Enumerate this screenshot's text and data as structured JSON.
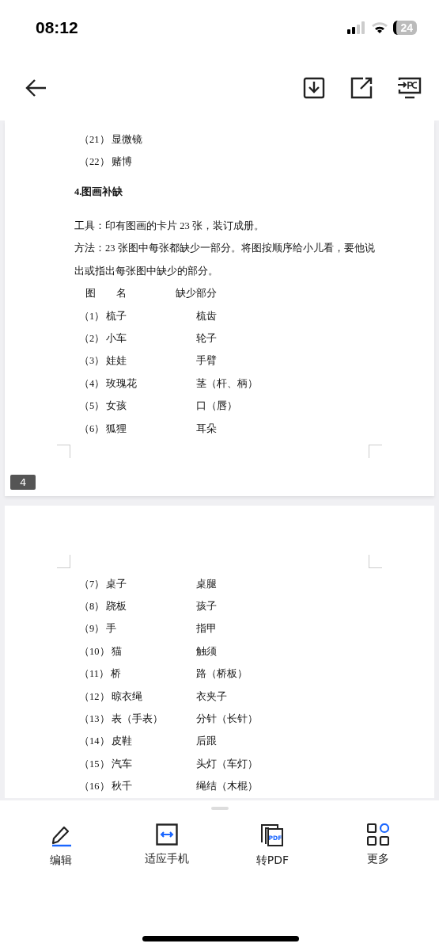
{
  "status_bar": {
    "time": "08:12",
    "battery": "24"
  },
  "document": {
    "pages": [
      {
        "blocks": [
          {
            "kind": "item",
            "number": "（21）",
            "name": "显微镜"
          },
          {
            "kind": "item",
            "number": "（22）",
            "name": "赌博"
          },
          {
            "kind": "heading",
            "text": "4.图画补缺"
          },
          {
            "kind": "para",
            "text": "工具：印有图画的卡片 23 张，装订成册。"
          },
          {
            "kind": "para",
            "text": "方法：23 张图中每张都缺少一部分。将图按顺序给小儿看，要他说"
          },
          {
            "kind": "para",
            "text": "出或指出每张图中缺少的部分。"
          },
          {
            "kind": "header",
            "col_1": "图　　名",
            "col_2": "缺少部分"
          },
          {
            "kind": "item",
            "number": "（1）",
            "name": "梳子",
            "missing": "梳齿"
          },
          {
            "kind": "item",
            "number": "（2）",
            "name": "小车",
            "missing": "轮子"
          },
          {
            "kind": "item",
            "number": "（3）",
            "name": "娃娃",
            "missing": "手臂"
          },
          {
            "kind": "item",
            "number": "（4）",
            "name": "玫瑰花",
            "missing": "茎（杆、柄）"
          },
          {
            "kind": "item",
            "number": "（5）",
            "name": "女孩",
            "missing": "口（唇）"
          },
          {
            "kind": "item",
            "number": "（6）",
            "name": "狐狸",
            "missing": "耳朵"
          }
        ],
        "page_number": "4"
      },
      {
        "blocks": [
          {
            "kind": "item",
            "number": "（7）",
            "name": "桌子",
            "missing": "桌腿"
          },
          {
            "kind": "item",
            "number": "（8）",
            "name": "跷板",
            "missing": "孩子"
          },
          {
            "kind": "item",
            "number": "（9）",
            "name": "手",
            "missing": "指甲"
          },
          {
            "kind": "item",
            "number": "（10）",
            "name": "猫",
            "missing": "触须"
          },
          {
            "kind": "item",
            "number": "（11）",
            "name": "桥",
            "missing": "路（桥板）"
          },
          {
            "kind": "item",
            "number": "（12）",
            "name": "晾衣绳",
            "missing": "衣夹子"
          },
          {
            "kind": "item",
            "number": "（13）",
            "name": "表（手表）",
            "missing": "分针（长针）"
          },
          {
            "kind": "item",
            "number": "（14）",
            "name": "皮鞋",
            "missing": "后跟"
          },
          {
            "kind": "item",
            "number": "（15）",
            "name": "汽车",
            "missing": "头灯（车灯）"
          },
          {
            "kind": "item",
            "number": "（16）",
            "name": "秋千",
            "missing": "绳结（木棍）"
          }
        ]
      }
    ]
  },
  "bottom_bar": [
    {
      "kind": "edit",
      "label": "编辑"
    },
    {
      "kind": "fit",
      "label": "适应手机"
    },
    {
      "kind": "pdf",
      "label": "转PDF",
      "icon_text": "PDF"
    },
    {
      "kind": "more",
      "label": "更多"
    }
  ]
}
